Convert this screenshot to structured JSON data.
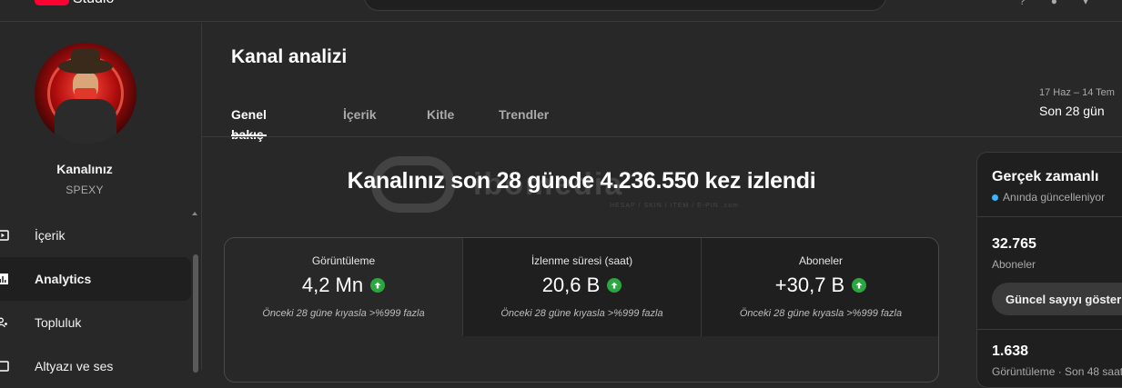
{
  "topbar": {
    "logo_text": "Studio"
  },
  "sidebar": {
    "channel_label": "Kanalınız",
    "channel_name": "SPEXY",
    "items": [
      {
        "label": "İçerik",
        "icon": "video-icon"
      },
      {
        "label": "Analytics",
        "icon": "analytics-icon",
        "active": true
      },
      {
        "label": "Topluluk",
        "icon": "community-icon"
      },
      {
        "label": "Altyazı ve ses",
        "icon": "subtitles-icon"
      }
    ]
  },
  "main": {
    "title": "Kanal analizi",
    "tabs": [
      {
        "label": "Genel bakış",
        "active": true
      },
      {
        "label": "İçerik"
      },
      {
        "label": "Kitle"
      },
      {
        "label": "Trendler"
      }
    ],
    "date_range": "17 Haz – 14 Tem",
    "date_label": "Son 28 gün",
    "headline": "Kanalınız son 28 günde 4.236.550 kez izlendi",
    "watermark": {
      "text": "ibomedia",
      "sub": "HESAP / SKIN / ITEM / E-PIN",
      "suffix": ".com"
    },
    "metrics": [
      {
        "label": "Görüntüleme",
        "value": "4,2 Mn",
        "compare": "Önceki 28 güne kıyasla >%999 fazla"
      },
      {
        "label": "İzlenme süresi (saat)",
        "value": "20,6 B",
        "compare": "Önceki 28 güne kıyasla >%999 fazla"
      },
      {
        "label": "Aboneler",
        "value": "+30,7 B",
        "compare": "Önceki 28 güne kıyasla >%999 fazla"
      }
    ]
  },
  "realtime": {
    "title": "Gerçek zamanlı",
    "status": "Anında güncelleniyor",
    "subscribers_value": "32.765",
    "subscribers_label": "Aboneler",
    "button_label": "Güncel sayıyı göster",
    "views_value": "1.638",
    "views_label": "Görüntüleme · Son 48 saat"
  },
  "colors": {
    "accent_red": "#ff0033",
    "up_green": "#2ba640",
    "live_blue": "#41b4f5"
  }
}
